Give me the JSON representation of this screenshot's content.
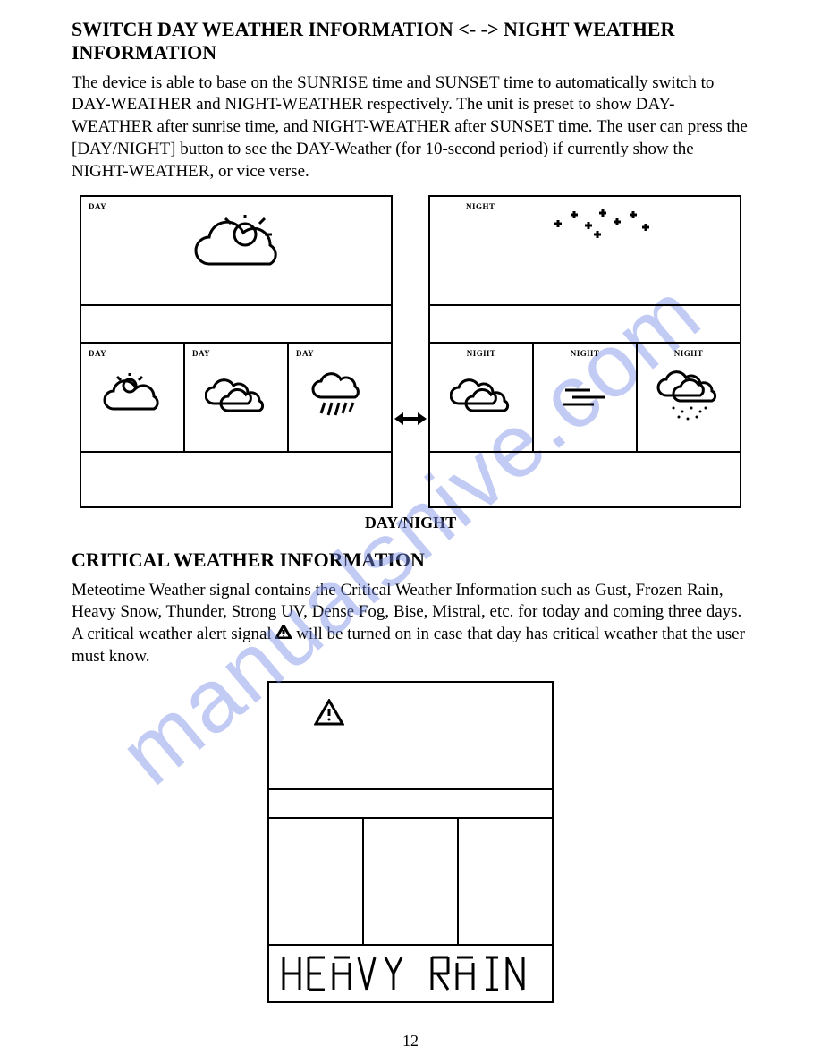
{
  "watermark": "manualsnive.com",
  "section1": {
    "heading": "SWITCH DAY WEATHER INFORMATION <- -> NIGHT WEATHER INFORMATION",
    "paragraph": "The device is able to base on the SUNRISE time and SUNSET time to automatically switch to DAY-WEATHER and NIGHT-WEATHER respectively. The unit is preset to show DAY-WEATHER after sunrise time, and NIGHT-WEATHER after SUNSET time. The user can press the [DAY/NIGHT] button to see the DAY-Weather (for 10-second period) if currently show the NIGHT-WEATHER, or vice verse.",
    "day_panel": {
      "top_label": "DAY",
      "top_icon": "sun-cloud",
      "cells": [
        {
          "label": "DAY",
          "icon": "sun-cloud"
        },
        {
          "label": "DAY",
          "icon": "two-clouds"
        },
        {
          "label": "DAY",
          "icon": "cloud-rain"
        }
      ]
    },
    "night_panel": {
      "top_label": "NIGHT",
      "top_icon": "stars",
      "cells": [
        {
          "label": "NIGHT",
          "icon": "two-clouds"
        },
        {
          "label": "NIGHT",
          "icon": "fog"
        },
        {
          "label": "NIGHT",
          "icon": "cloud-snow"
        }
      ]
    },
    "caption": "DAY/NIGHT"
  },
  "section2": {
    "heading": "CRITICAL WEATHER INFORMATION",
    "paragraph_part1": "Meteotime Weather signal contains the Critical Weather Information such as Gust, Frozen Rain, Heavy Snow, Thunder, Strong UV, Dense Fog, Bise, Mistral, etc. for today and coming three days. A critical weather alert signal ",
    "paragraph_part2": " will be turned on in case that day has critical weather that the user must know.",
    "panel": {
      "top_icon": "alert-triangle",
      "bottom_text": "HEAVY RAIN"
    }
  },
  "page_number": "12"
}
